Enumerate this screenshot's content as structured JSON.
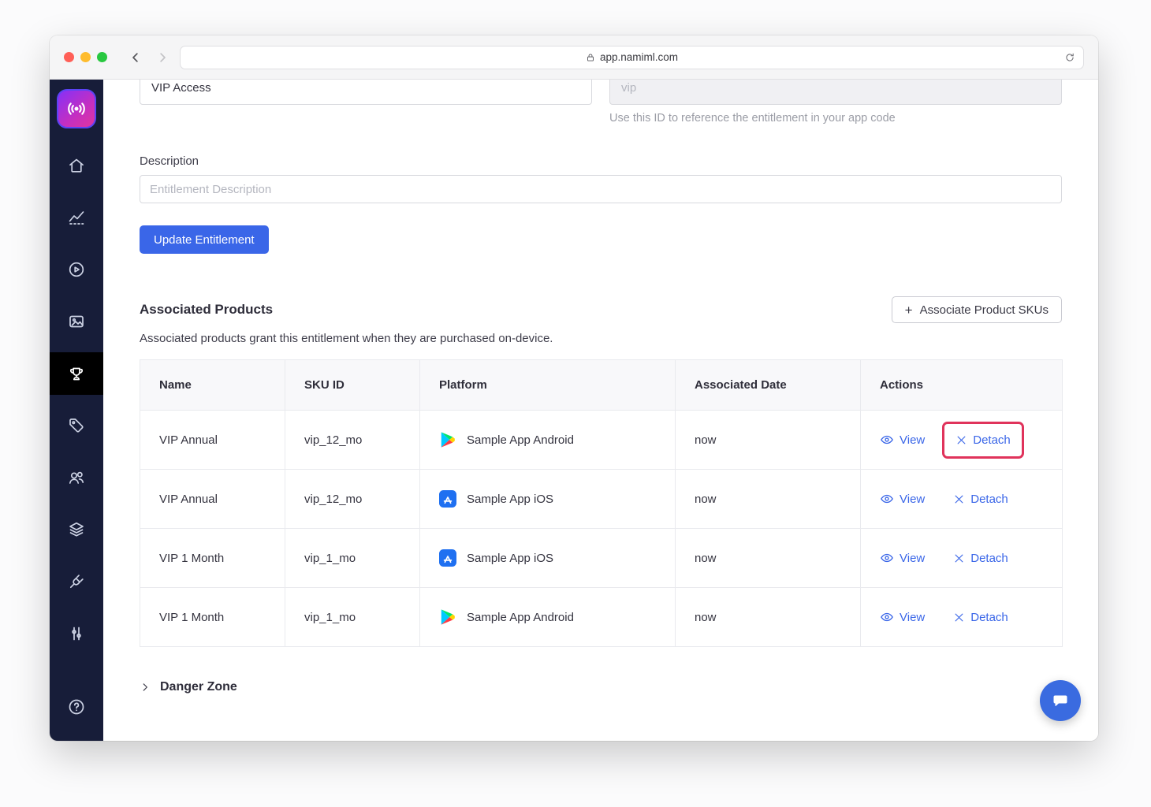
{
  "browser": {
    "url": "app.namiml.com"
  },
  "sidebar": {
    "logo": "nami-logo",
    "items": [
      {
        "icon": "home-icon"
      },
      {
        "icon": "analytics-icon"
      },
      {
        "icon": "campaigns-icon"
      },
      {
        "icon": "paywalls-icon"
      },
      {
        "icon": "entitlements-icon",
        "active": true
      },
      {
        "icon": "products-icon"
      },
      {
        "icon": "users-icon"
      },
      {
        "icon": "layers-icon"
      },
      {
        "icon": "integrations-icon"
      },
      {
        "icon": "settings-icon"
      },
      {
        "icon": "help-icon"
      }
    ]
  },
  "form": {
    "name_value": "VIP Access",
    "ref_placeholder": "vip",
    "ref_help": "Use this ID to reference the entitlement in your app code",
    "description_label": "Description",
    "description_placeholder": "Entitlement Description",
    "update_button": "Update Entitlement"
  },
  "associated": {
    "title": "Associated Products",
    "subtitle": "Associated products grant this entitlement when they are purchased on-device.",
    "associate_button": "Associate Product SKUs",
    "table": {
      "headers": [
        "Name",
        "SKU ID",
        "Platform",
        "Associated Date",
        "Actions"
      ],
      "rows": [
        {
          "name": "VIP Annual",
          "sku": "vip_12_mo",
          "platform": "Sample App Android",
          "platform_icon": "google-play-icon",
          "date": "now",
          "view": "View",
          "detach": "Detach",
          "detach_highlighted": true
        },
        {
          "name": "VIP Annual",
          "sku": "vip_12_mo",
          "platform": "Sample App iOS",
          "platform_icon": "app-store-icon",
          "date": "now",
          "view": "View",
          "detach": "Detach",
          "detach_highlighted": false
        },
        {
          "name": "VIP 1 Month",
          "sku": "vip_1_mo",
          "platform": "Sample App iOS",
          "platform_icon": "app-store-icon",
          "date": "now",
          "view": "View",
          "detach": "Detach",
          "detach_highlighted": false
        },
        {
          "name": "VIP 1 Month",
          "sku": "vip_1_mo",
          "platform": "Sample App Android",
          "platform_icon": "google-play-icon",
          "date": "now",
          "view": "View",
          "detach": "Detach",
          "detach_highlighted": false
        }
      ]
    }
  },
  "danger": {
    "label": "Danger Zone"
  },
  "colors": {
    "accent": "#3a66e8",
    "highlight_box": "#e0335b",
    "sidebar_bg": "#171d39"
  }
}
